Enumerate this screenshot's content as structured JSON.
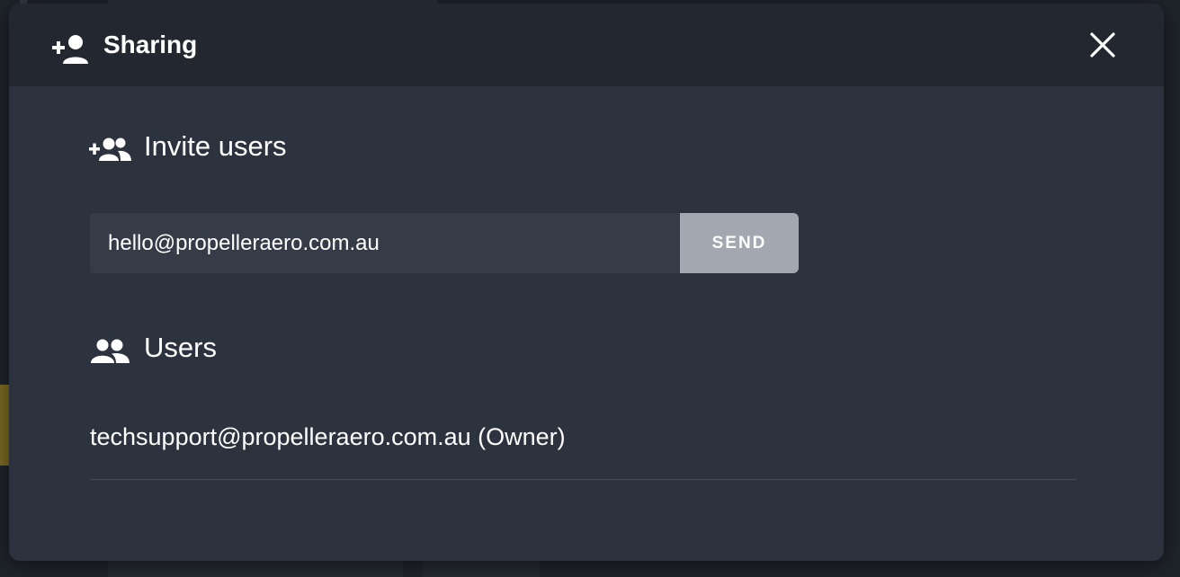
{
  "dialog": {
    "title": "Sharing",
    "close_icon": "close-icon",
    "header_icon": "person-add-icon"
  },
  "invite": {
    "title": "Invite users",
    "icon": "group-add-icon",
    "email_value": "hello@propelleraero.com.au",
    "send_label": "SEND"
  },
  "users": {
    "title": "Users",
    "icon": "people-icon",
    "list": [
      {
        "label": "techsupport@propelleraero.com.au (Owner)"
      }
    ]
  },
  "colors": {
    "modal_bg": "#2d333e",
    "header_bg": "#232830",
    "input_bg": "#363c47",
    "send_bg": "#a2a7b0",
    "text": "#ffffff"
  }
}
